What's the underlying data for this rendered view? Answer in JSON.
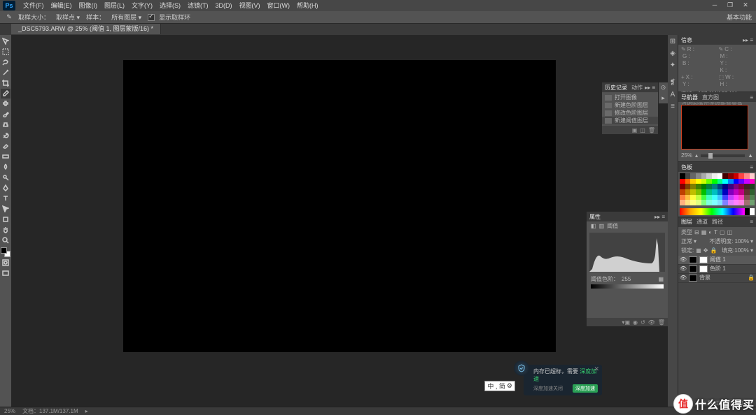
{
  "app": {
    "logo": "Ps"
  },
  "menu": [
    "文件(F)",
    "编辑(E)",
    "图像(I)",
    "图层(L)",
    "文字(Y)",
    "选择(S)",
    "滤镜(T)",
    "3D(D)",
    "视图(V)",
    "窗口(W)",
    "帮助(H)"
  ],
  "options": {
    "brush_size_label": "取样大小：",
    "sample_label": "取样点",
    "sample_target_label": "样本：",
    "sample_target_value": "所有图层",
    "show_sample_ring": "显示取样环",
    "workspace": "基本功能"
  },
  "doc_tab": "_DSC5793.ARW @ 25% (阈值 1, 图层蒙版/16) *",
  "history": {
    "tab1": "历史记录",
    "tab2": "动作",
    "items": [
      "打开图像",
      "新建色阶图层",
      "修改色阶图层",
      "新建阈值图层"
    ]
  },
  "properties": {
    "title": "属性",
    "type_label": "阈值",
    "threshold_label": "阈值色阶：",
    "threshold_value": "255"
  },
  "info": {
    "title": "信息",
    "R": "R :",
    "G": "G :",
    "B": "B :",
    "C": "C :",
    "M": "M :",
    "Y": "Y :",
    "K": "K :",
    "X": "X :",
    "Yc": "Y :",
    "W": "W :",
    "H": "H :",
    "doc": "文档：137.1M/137.1M",
    "hint": "点按图像可选取新背景色。"
  },
  "navigator": {
    "tab1": "导航器",
    "tab2": "直方图",
    "zoom": "25%"
  },
  "color": {
    "tab": "色板"
  },
  "layers": {
    "tabs": [
      "图层",
      "通道",
      "路径"
    ],
    "kind": "类型",
    "blend": "正常",
    "opacity_label": "不透明度:",
    "opacity": "100%",
    "lock_label": "锁定:",
    "fill_label": "填充:",
    "fill": "100%",
    "rows": [
      {
        "name": "阈值 1",
        "sel": true
      },
      {
        "name": "色阶 1",
        "sel": false
      },
      {
        "name": "背景",
        "sel": false,
        "locked": true
      }
    ]
  },
  "status": {
    "zoom": "25%",
    "doc": "文档：137.1M/137.1M"
  },
  "notif": {
    "line1_a": "内存已超标，需要 ",
    "line1_b": "深度加速",
    "sub": "深度加速关闭",
    "btn": "深度加速"
  },
  "ime": "中 , 简 ",
  "watermark": {
    "char": "值",
    "text": "什么值得买"
  },
  "swatch_colors": [
    "#000",
    "#444",
    "#666",
    "#888",
    "#aaa",
    "#ccc",
    "#eee",
    "#fff",
    "#400",
    "#800",
    "#c00",
    "#f44",
    "#f88",
    "#fcc",
    "#f00",
    "#f60",
    "#fc0",
    "#ff0",
    "#cf0",
    "#6f0",
    "#0f0",
    "#0f8",
    "#0ff",
    "#08f",
    "#00f",
    "#60f",
    "#c0f",
    "#f0c",
    "#800000",
    "#804000",
    "#808000",
    "#408000",
    "#008000",
    "#008040",
    "#008080",
    "#004080",
    "#000080",
    "#400080",
    "#800080",
    "#800040",
    "#402020",
    "#204020",
    "#c04000",
    "#c08000",
    "#c0c000",
    "#80c000",
    "#00c000",
    "#00c080",
    "#00c0c0",
    "#0080c0",
    "#0000c0",
    "#8000c0",
    "#c000c0",
    "#c00080",
    "#603030",
    "#306030",
    "#ff8040",
    "#ffc040",
    "#ffff40",
    "#c0ff40",
    "#40ff40",
    "#40ffc0",
    "#40ffff",
    "#40c0ff",
    "#4040ff",
    "#c040ff",
    "#ff40ff",
    "#ff40c0",
    "#805050",
    "#508050",
    "#ffb080",
    "#ffe080",
    "#ffff80",
    "#e0ff80",
    "#80ff80",
    "#80ffe0",
    "#80ffff",
    "#80e0ff",
    "#8080ff",
    "#e080ff",
    "#ff80ff",
    "#ff80e0",
    "#a07070",
    "#70a070"
  ]
}
